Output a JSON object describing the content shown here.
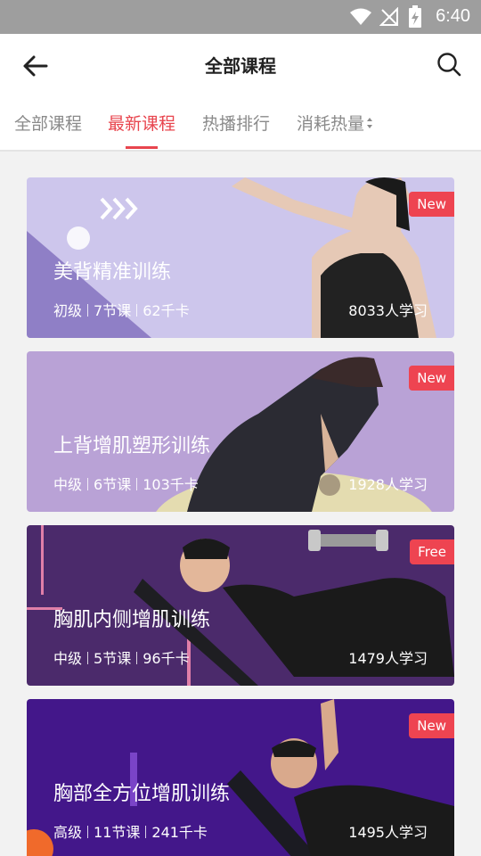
{
  "status_bar": {
    "time": "6:40"
  },
  "header": {
    "title": "全部课程"
  },
  "tabs": [
    {
      "label": "全部课程",
      "active": false
    },
    {
      "label": "最新课程",
      "active": true
    },
    {
      "label": "热播排行",
      "active": false
    },
    {
      "label": "消耗热量",
      "active": false
    }
  ],
  "courses": [
    {
      "title": "美背精准训练",
      "level": "初级",
      "lessons": "7节课",
      "calories": "62千卡",
      "learners": "8033人学习",
      "badge": "New",
      "theme": "lavender"
    },
    {
      "title": "上背增肌塑形训练",
      "level": "中级",
      "lessons": "6节课",
      "calories": "103千卡",
      "learners": "1928人学习",
      "badge": "New",
      "theme": "violet"
    },
    {
      "title": "胸肌内侧增肌训练",
      "level": "中级",
      "lessons": "5节课",
      "calories": "96千卡",
      "learners": "1479人学习",
      "badge": "Free",
      "theme": "plum"
    },
    {
      "title": "胸部全方位增肌训练",
      "level": "高级",
      "lessons": "11节课",
      "calories": "241千卡",
      "learners": "1495人学习",
      "badge": "New",
      "theme": "indigo"
    }
  ],
  "colors": {
    "accent": "#e8454e",
    "badge": "#ee4451"
  }
}
